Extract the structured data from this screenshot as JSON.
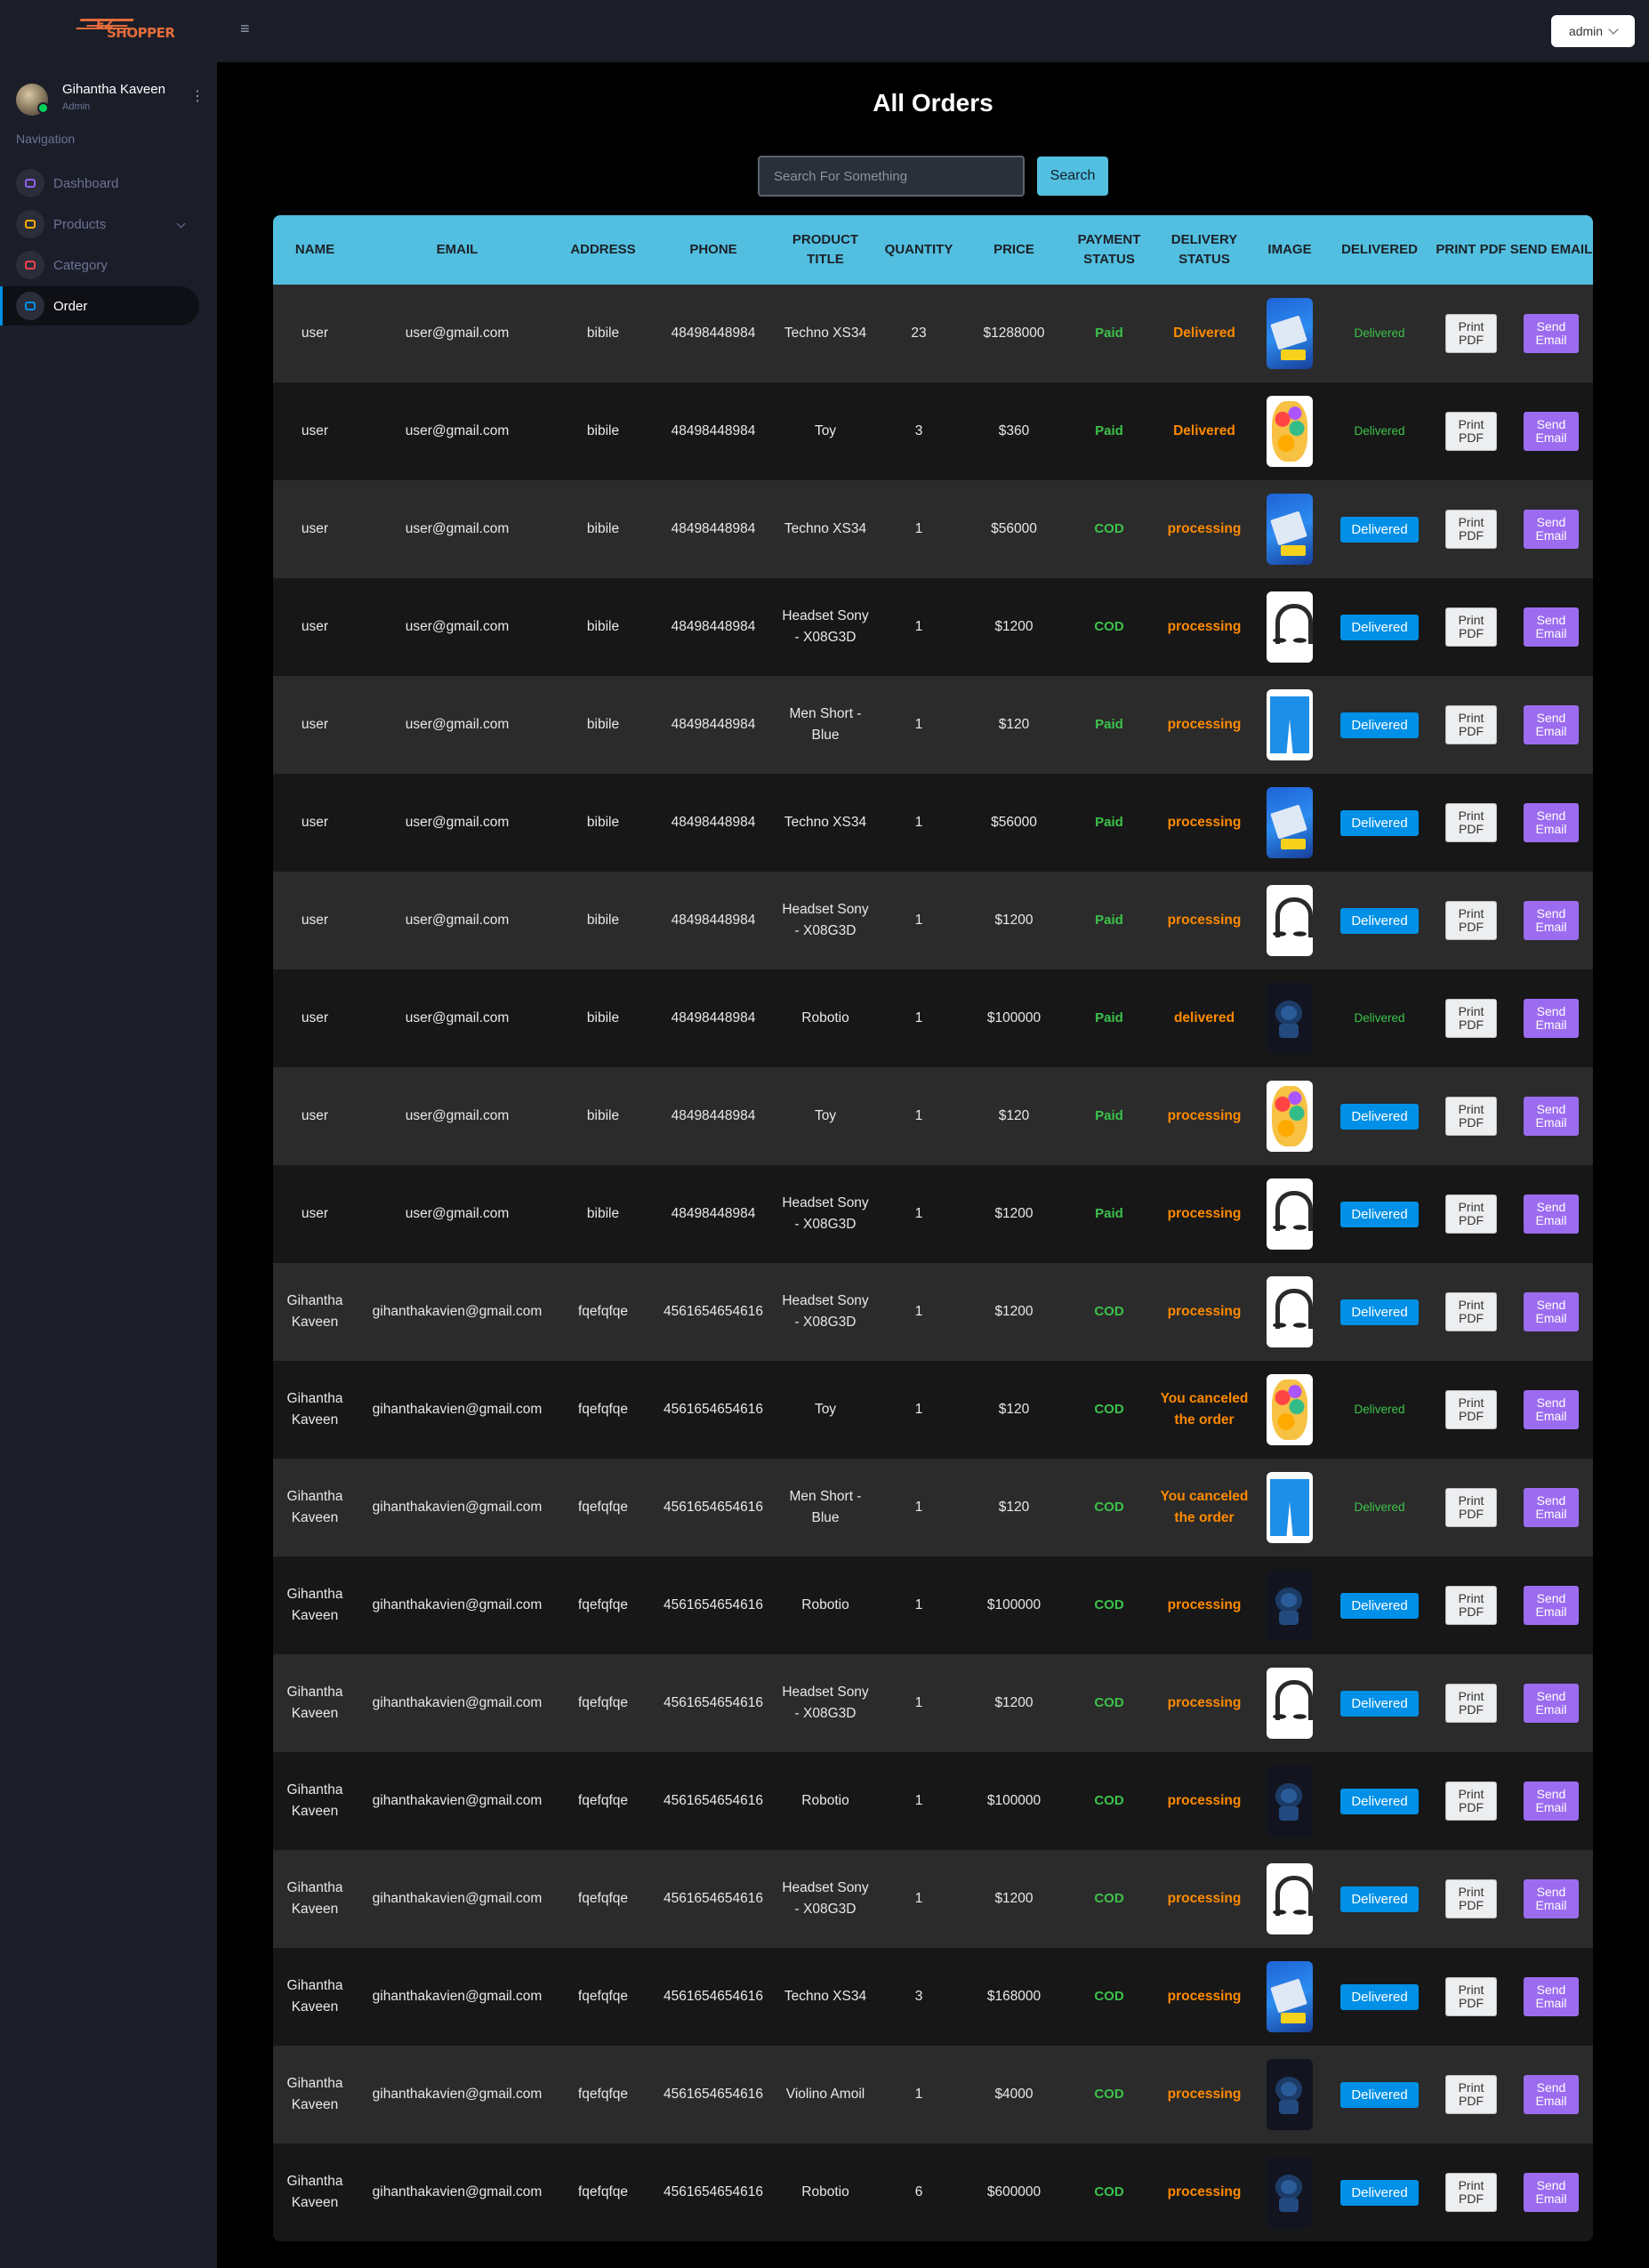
{
  "topbar": {
    "logo_ez": "EZ",
    "logo_text": "SHOPPER",
    "admin_label": "admin"
  },
  "sidebar": {
    "profile_name": "Gihantha Kaveen",
    "profile_role": "Admin",
    "nav_title": "Navigation",
    "items": [
      {
        "label": "Dashboard",
        "icon": "speedometer-icon",
        "color": "#8f5fe8",
        "active": false
      },
      {
        "label": "Products",
        "icon": "laptop-icon",
        "color": "#ffab00",
        "active": false
      },
      {
        "label": "Category",
        "icon": "playlist-icon",
        "color": "#fc424a",
        "active": false
      },
      {
        "label": "Order",
        "icon": "cart-icon",
        "color": "#0090e7",
        "active": true
      }
    ]
  },
  "page_title": "All Orders",
  "search": {
    "placeholder": "Search For Something",
    "button": "Search"
  },
  "table": {
    "headers": [
      "NAME",
      "EMAIL",
      "ADDRESS",
      "PHONE",
      "PRODUCT TITLE",
      "QUANTITY",
      "PRICE",
      "PAYMENT STATUS",
      "DELIVERY STATUS",
      "IMAGE",
      "DELIVERED",
      "PRINT PDF",
      "SEND EMAIL"
    ],
    "print_label": "Print PDF",
    "email_label": "Send Email",
    "delivered_label": "Delivered",
    "rows": [
      {
        "name": "user",
        "email": "user@gmail.com",
        "address": "bibile",
        "phone": "48498448984",
        "title": "Techno XS34",
        "qty": "23",
        "price": "$1288000",
        "payment": "Paid",
        "delivery": "Delivered",
        "image": "techno",
        "delivered_state": "text"
      },
      {
        "name": "user",
        "email": "user@gmail.com",
        "address": "bibile",
        "phone": "48498448984",
        "title": "Toy",
        "qty": "3",
        "price": "$360",
        "payment": "Paid",
        "delivery": "Delivered",
        "image": "toy",
        "delivered_state": "text"
      },
      {
        "name": "user",
        "email": "user@gmail.com",
        "address": "bibile",
        "phone": "48498448984",
        "title": "Techno XS34",
        "qty": "1",
        "price": "$56000",
        "payment": "COD",
        "delivery": "processing",
        "image": "techno",
        "delivered_state": "button"
      },
      {
        "name": "user",
        "email": "user@gmail.com",
        "address": "bibile",
        "phone": "48498448984",
        "title": "Headset Sony - X08G3D",
        "qty": "1",
        "price": "$1200",
        "payment": "COD",
        "delivery": "processing",
        "image": "headset",
        "delivered_state": "button"
      },
      {
        "name": "user",
        "email": "user@gmail.com",
        "address": "bibile",
        "phone": "48498448984",
        "title": "Men Short - Blue",
        "qty": "1",
        "price": "$120",
        "payment": "Paid",
        "delivery": "processing",
        "image": "shorts",
        "delivered_state": "button"
      },
      {
        "name": "user",
        "email": "user@gmail.com",
        "address": "bibile",
        "phone": "48498448984",
        "title": "Techno XS34",
        "qty": "1",
        "price": "$56000",
        "payment": "Paid",
        "delivery": "processing",
        "image": "techno",
        "delivered_state": "button"
      },
      {
        "name": "user",
        "email": "user@gmail.com",
        "address": "bibile",
        "phone": "48498448984",
        "title": "Headset Sony - X08G3D",
        "qty": "1",
        "price": "$1200",
        "payment": "Paid",
        "delivery": "processing",
        "image": "headset",
        "delivered_state": "button"
      },
      {
        "name": "user",
        "email": "user@gmail.com",
        "address": "bibile",
        "phone": "48498448984",
        "title": "Robotio",
        "qty": "1",
        "price": "$100000",
        "payment": "Paid",
        "delivery": "delivered",
        "image": "robot",
        "delivered_state": "text"
      },
      {
        "name": "user",
        "email": "user@gmail.com",
        "address": "bibile",
        "phone": "48498448984",
        "title": "Toy",
        "qty": "1",
        "price": "$120",
        "payment": "Paid",
        "delivery": "processing",
        "image": "toy",
        "delivered_state": "button"
      },
      {
        "name": "user",
        "email": "user@gmail.com",
        "address": "bibile",
        "phone": "48498448984",
        "title": "Headset Sony - X08G3D",
        "qty": "1",
        "price": "$1200",
        "payment": "Paid",
        "delivery": "processing",
        "image": "headset",
        "delivered_state": "button"
      },
      {
        "name": "Gihantha Kaveen",
        "email": "gihanthakavien@gmail.com",
        "address": "fqefqfqe",
        "phone": "4561654654616",
        "title": "Headset Sony - X08G3D",
        "qty": "1",
        "price": "$1200",
        "payment": "COD",
        "delivery": "processing",
        "image": "headset",
        "delivered_state": "button"
      },
      {
        "name": "Gihantha Kaveen",
        "email": "gihanthakavien@gmail.com",
        "address": "fqefqfqe",
        "phone": "4561654654616",
        "title": "Toy",
        "qty": "1",
        "price": "$120",
        "payment": "COD",
        "delivery": "You canceled the order",
        "image": "toy",
        "delivered_state": "text"
      },
      {
        "name": "Gihantha Kaveen",
        "email": "gihanthakavien@gmail.com",
        "address": "fqefqfqe",
        "phone": "4561654654616",
        "title": "Men Short - Blue",
        "qty": "1",
        "price": "$120",
        "payment": "COD",
        "delivery": "You canceled the order",
        "image": "shorts",
        "delivered_state": "text"
      },
      {
        "name": "Gihantha Kaveen",
        "email": "gihanthakavien@gmail.com",
        "address": "fqefqfqe",
        "phone": "4561654654616",
        "title": "Robotio",
        "qty": "1",
        "price": "$100000",
        "payment": "COD",
        "delivery": "processing",
        "image": "robot",
        "delivered_state": "button"
      },
      {
        "name": "Gihantha Kaveen",
        "email": "gihanthakavien@gmail.com",
        "address": "fqefqfqe",
        "phone": "4561654654616",
        "title": "Headset Sony - X08G3D",
        "qty": "1",
        "price": "$1200",
        "payment": "COD",
        "delivery": "processing",
        "image": "headset",
        "delivered_state": "button"
      },
      {
        "name": "Gihantha Kaveen",
        "email": "gihanthakavien@gmail.com",
        "address": "fqefqfqe",
        "phone": "4561654654616",
        "title": "Robotio",
        "qty": "1",
        "price": "$100000",
        "payment": "COD",
        "delivery": "processing",
        "image": "robot",
        "delivered_state": "button"
      },
      {
        "name": "Gihantha Kaveen",
        "email": "gihanthakavien@gmail.com",
        "address": "fqefqfqe",
        "phone": "4561654654616",
        "title": "Headset Sony - X08G3D",
        "qty": "1",
        "price": "$1200",
        "payment": "COD",
        "delivery": "processing",
        "image": "headset",
        "delivered_state": "button"
      },
      {
        "name": "Gihantha Kaveen",
        "email": "gihanthakavien@gmail.com",
        "address": "fqefqfqe",
        "phone": "4561654654616",
        "title": "Techno XS34",
        "qty": "3",
        "price": "$168000",
        "payment": "COD",
        "delivery": "processing",
        "image": "techno",
        "delivered_state": "button"
      },
      {
        "name": "Gihantha Kaveen",
        "email": "gihanthakavien@gmail.com",
        "address": "fqefqfqe",
        "phone": "4561654654616",
        "title": "Violino Amoil",
        "qty": "1",
        "price": "$4000",
        "payment": "COD",
        "delivery": "processing",
        "image": "robot",
        "delivered_state": "button"
      },
      {
        "name": "Gihantha Kaveen",
        "email": "gihanthakavien@gmail.com",
        "address": "fqefqfqe",
        "phone": "4561654654616",
        "title": "Robotio",
        "qty": "6",
        "price": "$600000",
        "payment": "COD",
        "delivery": "processing",
        "image": "robot",
        "delivered_state": "button"
      }
    ]
  }
}
